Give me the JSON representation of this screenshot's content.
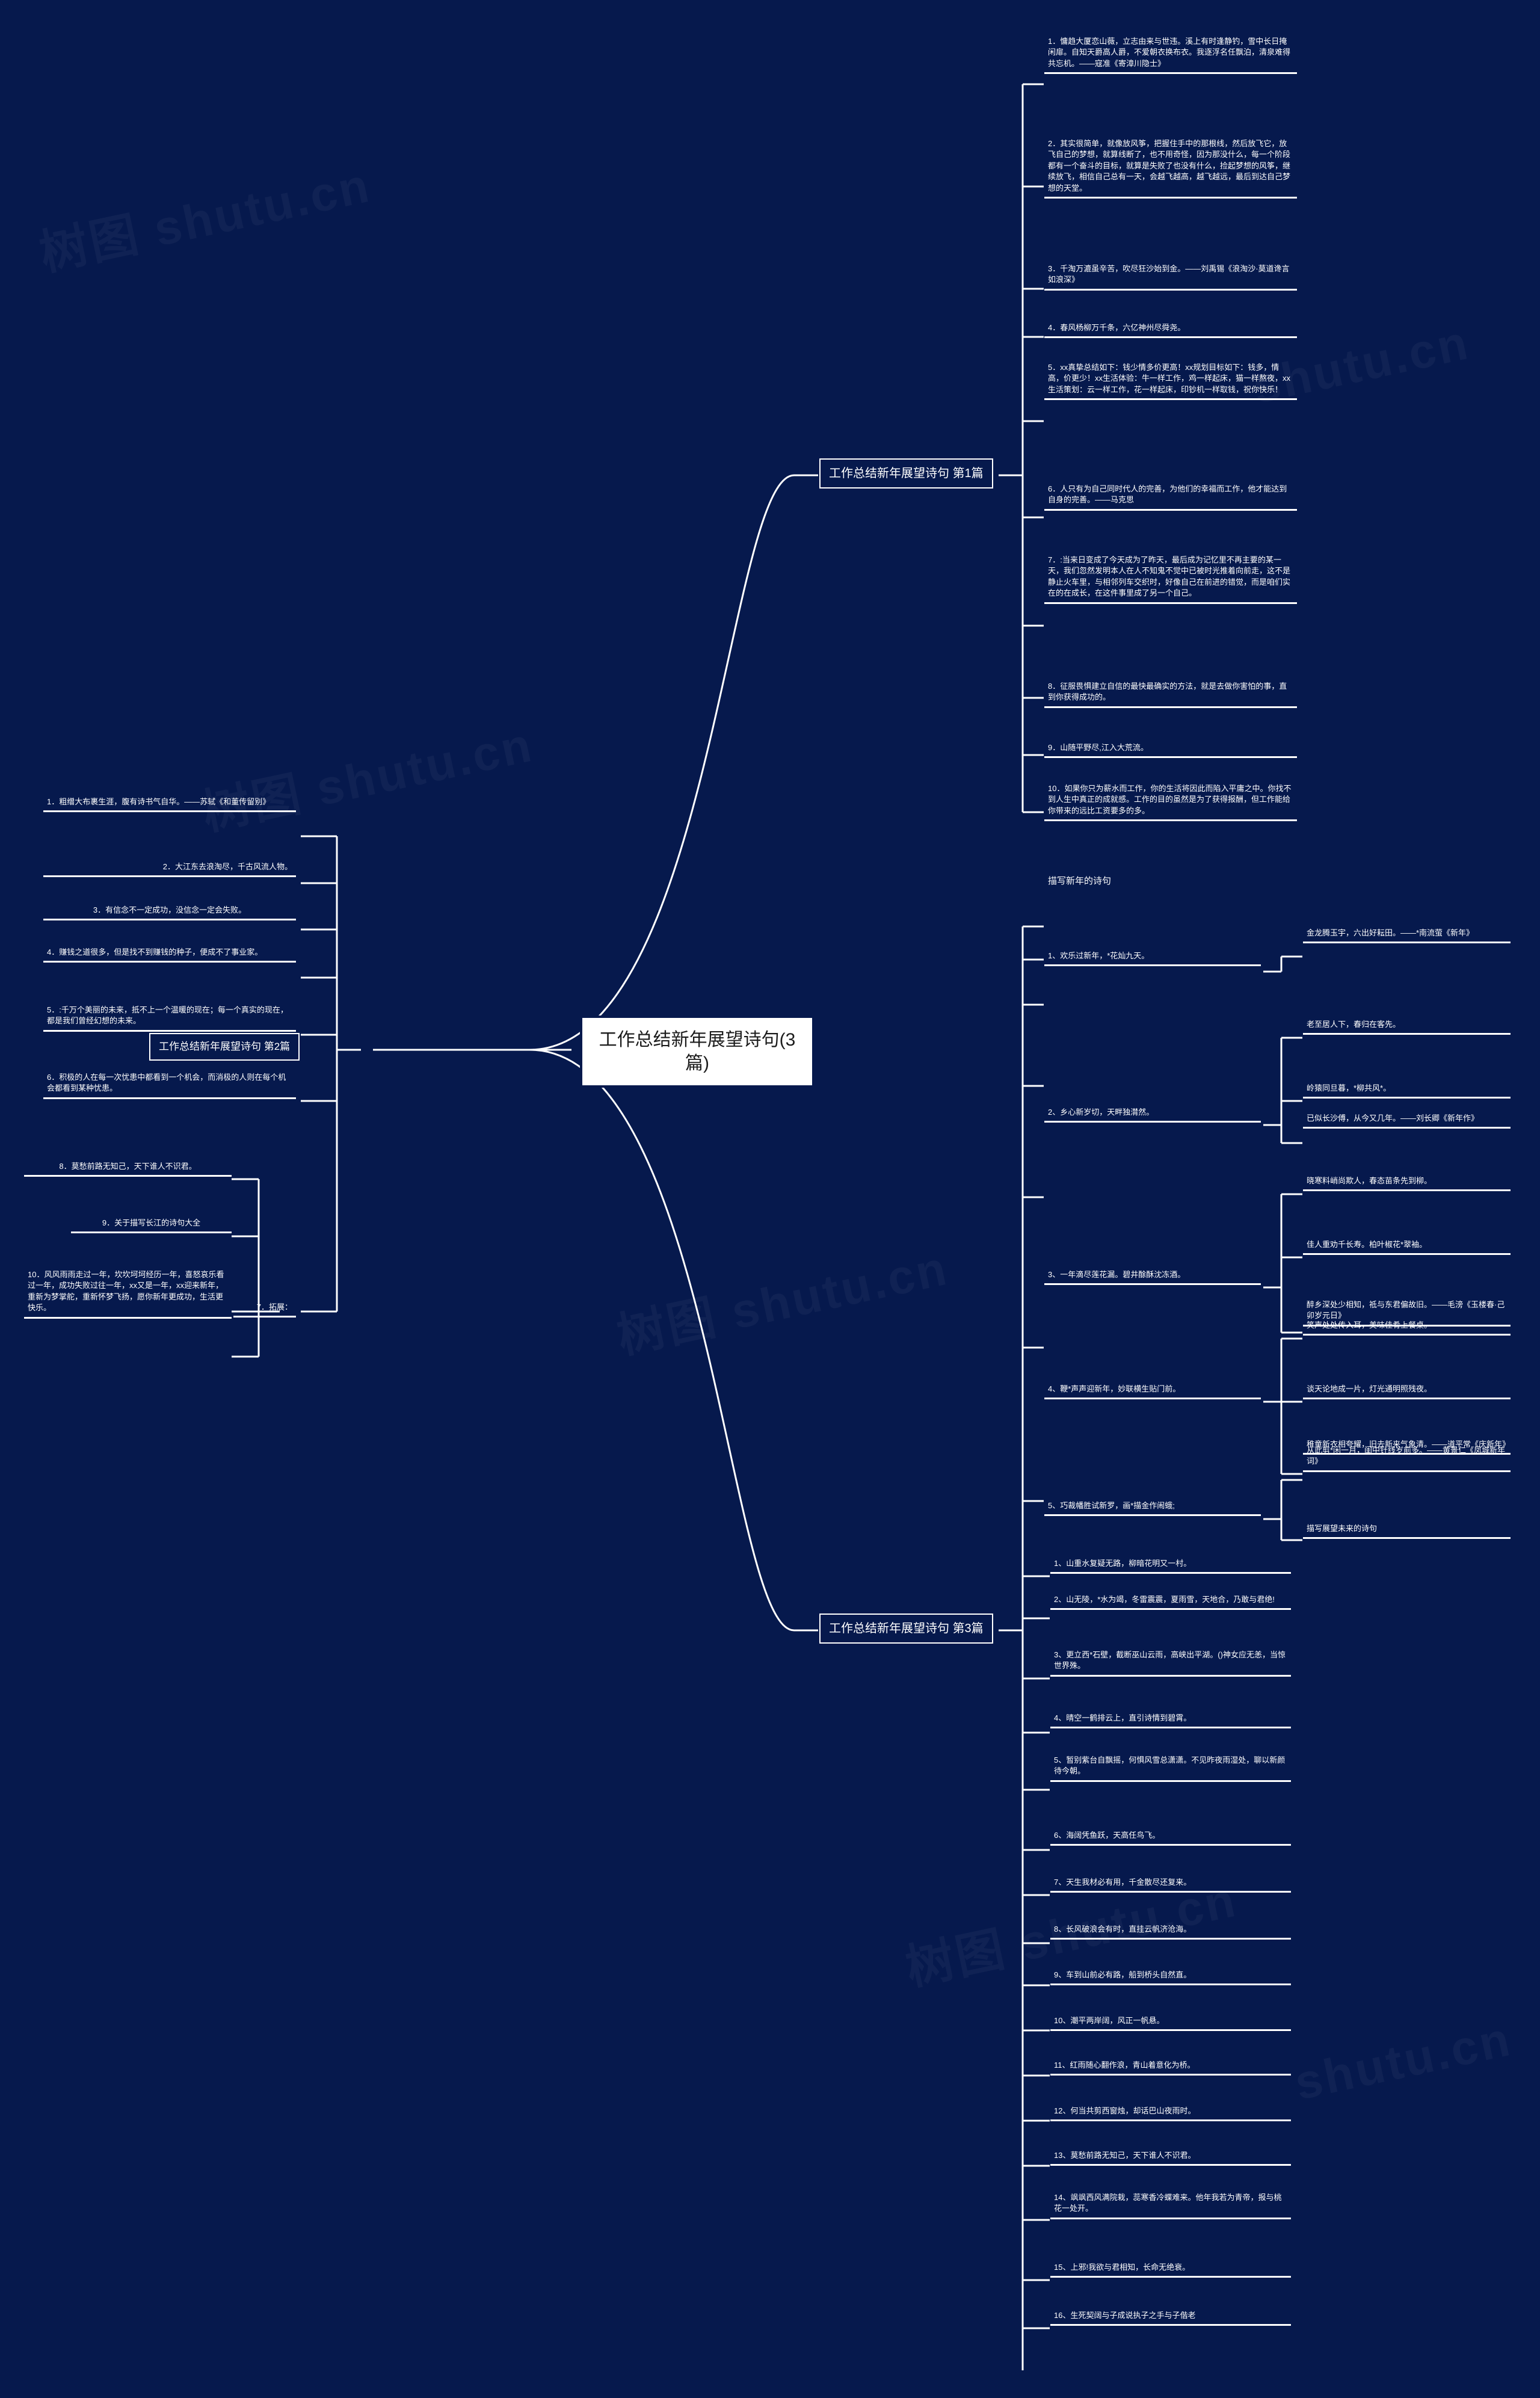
{
  "theme": {
    "background": "#06194d",
    "node_text": "#ffffff",
    "root_bg": "#ffffff",
    "root_text": "#1b1b1b",
    "connector": "#ffffff"
  },
  "watermarks": [
    "树图 shutu.cn",
    "树图 shutu.cn",
    "树图 shutu.cn",
    "树图 shutu.cn",
    "shutu.cn",
    "shutu.cn"
  ],
  "root": {
    "title": "工作总结新年展望诗句(3篇)"
  },
  "branches": [
    {
      "id": "pian1",
      "label": "工作总结新年展望诗句 第1篇",
      "items": [
        "1．慵趋大厦恋山薇，立志由来与世违。溪上有时逢静钓，雪中长日掩闲扉。自知天爵高人爵，不爱朝衣换布衣。我逐浮名任飘泊，清泉难得共忘机。——寇准《寄漳川隐士》",
        "2．其实很简单，就像放风筝，把握住手中的那根线，然后放飞它，放飞自己的梦想，就算线断了，也不用奇怪，因为那没什么，每一个阶段都有一个奋斗的目标，就算是失败了也没有什么，捡起梦想的风筝，继续放飞，相信自己总有一天，会越飞越高，越飞越远，最后到达自己梦想的天堂。",
        "3．千淘万漉虽辛苦，吹尽狂沙始到金。——刘禹锡《浪淘沙·莫道谗言如浪深》",
        "4．春风杨柳万千条，六亿神州尽舜尧。",
        "5．xx真挚总结如下：钱少情多价更高！xx规划目标如下：钱多，情高，价更少！xx生活体验：牛一样工作，鸡一样起床，猫一样熬夜，xx生活策划：云一样工作，花一样起床，印钞机一样取钱，祝你快乐！",
        "6．人只有为自己同时代人的完善，为他们的幸福而工作，他才能达到自身的完善。——马克思",
        "7．:当来日变成了今天成为了昨天，最后成为记忆里不再主要的某一天，我们忽然发明本人在人不知鬼不觉中已被时光推着向前走，这不是静止火车里，与相邻列车交织时，好像自己在前进的错觉，而是咱们实在的在成长，在这件事里成了另一个自己。",
        "8．征服畏惧建立自信的最快最确实的方法，就是去做你害怕的事，直到你获得成功的。",
        "9．山随平野尽,江入大荒流。",
        "10．如果你只为薪水而工作，你的生活将因此而陷入平庸之中。你找不到人生中真正的成就感。工作的目的虽然是为了获得报酬，但工作能给你带来的远比工资要多的多。"
      ]
    },
    {
      "id": "pian2",
      "label": "工作总结新年展望诗句 第2篇",
      "items": [
        "1．粗缯大布裹生涯，腹有诗书气自华。——苏轼《和董传留别》",
        "2．大江东去浪淘尽，千古风流人物。",
        "3．有信念不一定成功，没信念一定会失败。",
        "4．赚钱之道很多，但是找不到赚钱的种子，便成不了事业家。",
        "5．:千万个美丽的未来，抵不上一个温暖的现在；每一个真实的现在，都是我们曾经幻想的未来。",
        "6．积极的人在每一次忧患中都看到一个机会，而消极的人则在每个机会都看到某种忧患。"
      ],
      "expand": {
        "label": "7．拓展：",
        "items": [
          "8．莫愁前路无知己，天下谁人不识君。",
          "9．关于描写长江的诗句大全",
          "10．风风雨雨走过一年，坎坎坷坷经历一年，喜怒哀乐看过一年，成功失败过往一年，xx又是一年，xx迎来新年，重新为梦掌舵，重新怀梦飞扬，愿你新年更成功，生活更快乐。"
        ]
      }
    },
    {
      "id": "pian3",
      "label": "工作总结新年展望诗句 第3篇",
      "section_caption": "描写新年的诗句",
      "groups": [
        {
          "label": "1、欢乐过新年，*花灿九天。",
          "children": [
            "金龙腾玉宇，六出好耘田。——*南流萤《新年》"
          ]
        },
        {
          "label": "2、乡心新岁切，天畔独潸然。",
          "children": [
            "老至居人下，春归在客先。",
            "岭猿同旦暮，*柳共风*。",
            "已似长沙傅，从今又几年。——刘长卿《新年作》"
          ]
        },
        {
          "label": "3、一年滴尽莲花漏。碧井酴酥沈冻酒。",
          "children": [
            "晓寒料峭尚欺人，春态苗条先到柳。",
            "佳人重劝千长寿。柏叶椒花*翠袖。",
            "醉乡深处少相知，祗与东君偏故旧。——毛滂《玉楼春·己卯岁元日》"
          ]
        },
        {
          "label": "4、鞭*声声迎新年，妙联横生贴门前。",
          "children": [
            "笑声处处传入耳，美味佳肴上餐桌。",
            "谈天论地成一片，灯光通明照残夜。",
            "稚童新衣相夸耀，旧去新来气象清。——道平常《庆新年》"
          ]
        },
        {
          "label": "5、巧裁幡胜试新罗，画*描金作闹蛾;",
          "children": [
            "从此剪*闲一月，闺中针线岁前多。——黄景仁《凤城新年词》",
            "描写展望未来的诗句"
          ]
        }
      ],
      "items": [
        "1、山重水复疑无路，柳暗花明又一村。",
        "2、山无陵，*水为竭，冬雷震震，夏雨雪，天地合，乃敢与君绝!",
        "3、更立西*石壁，截断巫山云雨，高峡出平湖。()神女应无恙，当惊世界殊。",
        "4、晴空一鹤排云上，直引诗情到碧霄。",
        "5、暂别紫台自飘摇，何惧风雪总潇潇。不见昨夜雨湿处，聊以新颜待今朝。",
        "6、海阔凭鱼跃，天高任鸟飞。",
        "7、天生我材必有用，千金散尽还复来。",
        "8、长风破浪会有时，直挂云帆济沧海。",
        "9、车到山前必有路，船到桥头自然直。",
        "10、潮平两岸阔，风正一帆悬。",
        "11、红雨随心翻作浪，青山着意化为桥。",
        "12、何当共剪西窗烛，却话巴山夜雨时。",
        "13、莫愁前路无知己，天下谁人不识君。",
        "14、飒飒西风满院栽，蕊寒香冷蝶难来。他年我若为青帝，报与桃花一处开。",
        "15、上邪!我欲与君相知，长命无绝衰。",
        "16、生死契阔与子成说执子之手与子偕老"
      ]
    }
  ]
}
